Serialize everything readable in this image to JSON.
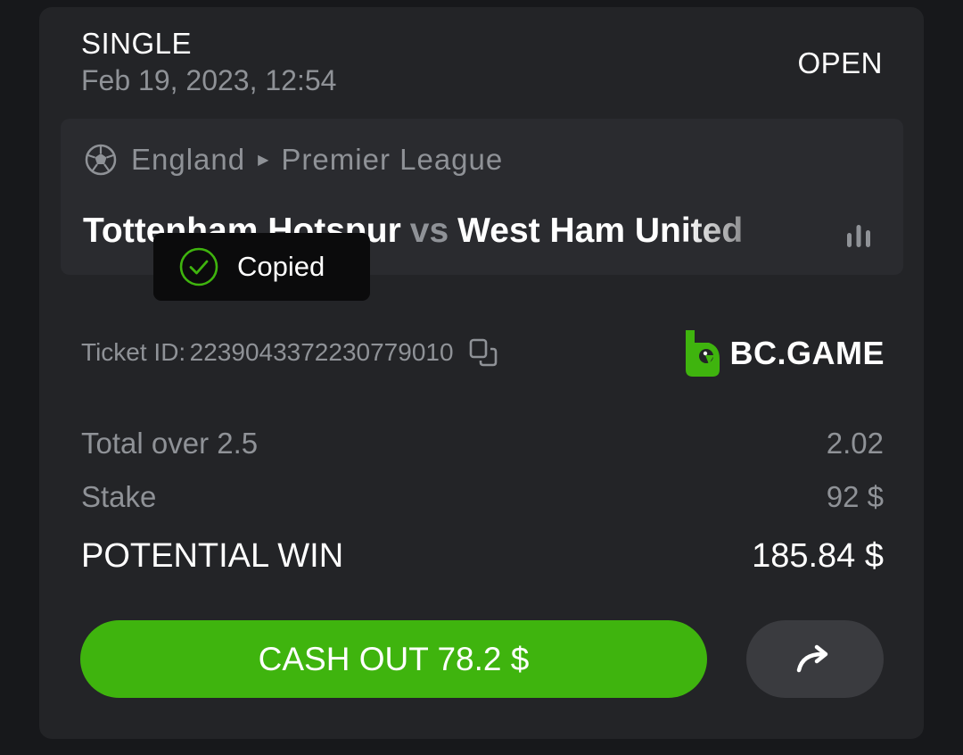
{
  "bet": {
    "type": "SINGLE",
    "date": "Feb 19, 2023, 12:54",
    "status": "OPEN"
  },
  "match": {
    "sport_icon": "soccer-ball-icon",
    "country": "England",
    "league": "Premier League",
    "home_team": "Tottenham Hotspur",
    "vs": "vs",
    "away_team": "West Ham United",
    "stats_icon": "bar-chart-icon"
  },
  "toast": {
    "icon": "check-circle-icon",
    "text": "Copied"
  },
  "ticket": {
    "label": "Ticket ID:",
    "id": "2239043372230779010",
    "copy_icon": "copy-icon"
  },
  "brand": {
    "name": "BC.GAME",
    "color": "#3fb40e"
  },
  "summary": {
    "market_label": "Total over 2.5",
    "market_odds": "2.02",
    "stake_label": "Stake",
    "stake_value": "92 $",
    "win_label": "POTENTIAL WIN",
    "win_value": "185.84 $"
  },
  "actions": {
    "cashout_label": "CASH OUT 78.2 $",
    "share_icon": "share-arrow-icon"
  },
  "colors": {
    "background": "#17181b",
    "card": "#232427",
    "accent_green": "#3fb40e",
    "muted_text": "#8f9297"
  }
}
